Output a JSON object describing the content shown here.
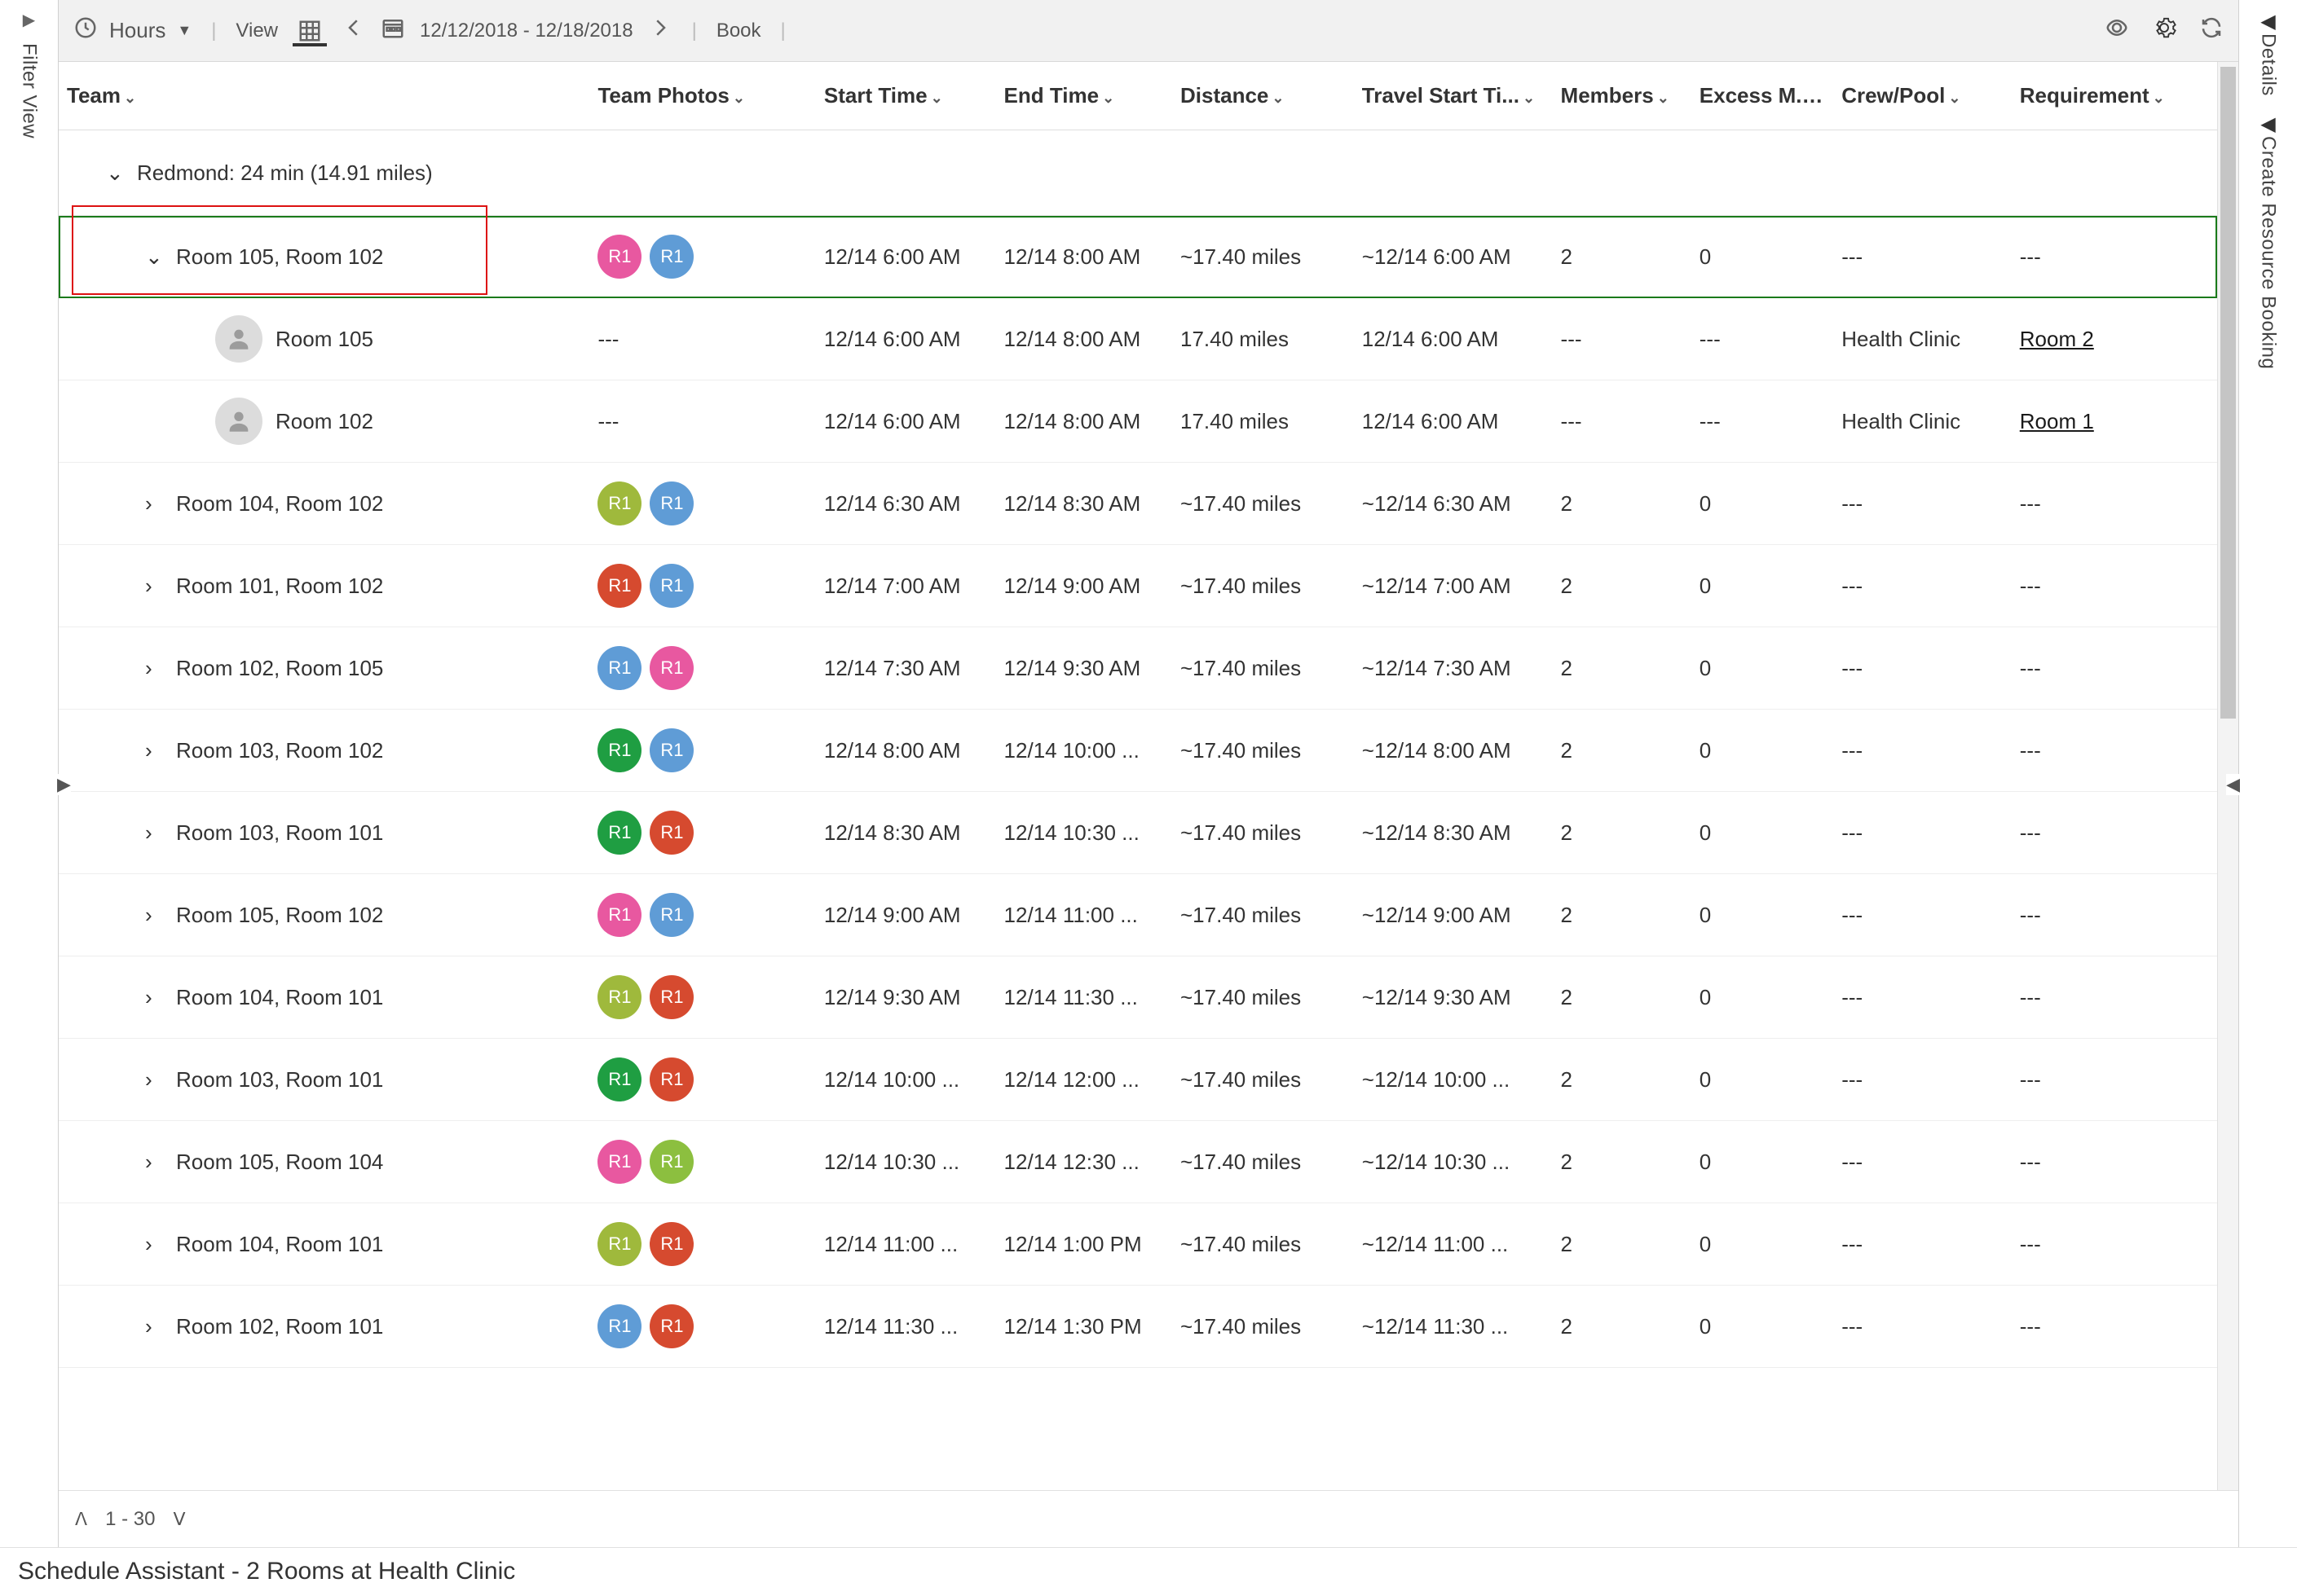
{
  "toolbar": {
    "hours_label": "Hours",
    "view_label": "View",
    "date_range": "12/12/2018 - 12/18/2018",
    "book_label": "Book"
  },
  "left_rail": {
    "label": "Filter View"
  },
  "right_rail_1": {
    "label": "Details"
  },
  "right_rail_2": {
    "label": "Create Resource Booking"
  },
  "columns": {
    "team": "Team",
    "photos": "Team Photos",
    "start": "Start Time",
    "end": "End Time",
    "distance": "Distance",
    "travel_start": "Travel Start Ti...",
    "members": "Members",
    "excess": "Excess M...",
    "crew": "Crew/Pool",
    "req": "Requirement"
  },
  "group": {
    "label": "Redmond: 24 min (14.91 miles)"
  },
  "avatar_text": "R1",
  "rows": [
    {
      "id": 0,
      "expanded": true,
      "pad": 2,
      "team": "Room 105, Room 102",
      "av1": "pink",
      "av2": "blue",
      "start": "12/14 6:00 AM",
      "end": "12/14 8:00 AM",
      "dist": "~17.40 miles",
      "trs": "~12/14 6:00 AM",
      "members": "2",
      "excess": "0",
      "crew": "---",
      "req": "---",
      "selected": true
    },
    {
      "id": 1,
      "leaf": true,
      "pad": 3,
      "team": "Room 105",
      "photos": "---",
      "start": "12/14 6:00 AM",
      "end": "12/14 8:00 AM",
      "dist": "17.40 miles",
      "trs": "12/14 6:00 AM",
      "members": "---",
      "excess": "---",
      "crew": "Health Clinic",
      "req": "Room 2",
      "req_link": true
    },
    {
      "id": 2,
      "leaf": true,
      "pad": 3,
      "team": "Room 102",
      "photos": "---",
      "start": "12/14 6:00 AM",
      "end": "12/14 8:00 AM",
      "dist": "17.40 miles",
      "trs": "12/14 6:00 AM",
      "members": "---",
      "excess": "---",
      "crew": "Health Clinic",
      "req": "Room 1",
      "req_link": true
    },
    {
      "id": 3,
      "pad": 2,
      "team": "Room 104, Room 102",
      "av1": "olive",
      "av2": "blue",
      "start": "12/14 6:30 AM",
      "end": "12/14 8:30 AM",
      "dist": "~17.40 miles",
      "trs": "~12/14 6:30 AM",
      "members": "2",
      "excess": "0",
      "crew": "---",
      "req": "---"
    },
    {
      "id": 4,
      "pad": 2,
      "team": "Room 101, Room 102",
      "av1": "red",
      "av2": "blue",
      "start": "12/14 7:00 AM",
      "end": "12/14 9:00 AM",
      "dist": "~17.40 miles",
      "trs": "~12/14 7:00 AM",
      "members": "2",
      "excess": "0",
      "crew": "---",
      "req": "---"
    },
    {
      "id": 5,
      "pad": 2,
      "team": "Room 102, Room 105",
      "av1": "blue",
      "av2": "pink",
      "start": "12/14 7:30 AM",
      "end": "12/14 9:30 AM",
      "dist": "~17.40 miles",
      "trs": "~12/14 7:30 AM",
      "members": "2",
      "excess": "0",
      "crew": "---",
      "req": "---"
    },
    {
      "id": 6,
      "pad": 2,
      "team": "Room 103, Room 102",
      "av1": "green",
      "av2": "blue",
      "start": "12/14 8:00 AM",
      "end": "12/14 10:00 ...",
      "dist": "~17.40 miles",
      "trs": "~12/14 8:00 AM",
      "members": "2",
      "excess": "0",
      "crew": "---",
      "req": "---"
    },
    {
      "id": 7,
      "pad": 2,
      "team": "Room 103, Room 101",
      "av1": "green",
      "av2": "red",
      "start": "12/14 8:30 AM",
      "end": "12/14 10:30 ...",
      "dist": "~17.40 miles",
      "trs": "~12/14 8:30 AM",
      "members": "2",
      "excess": "0",
      "crew": "---",
      "req": "---"
    },
    {
      "id": 8,
      "pad": 2,
      "team": "Room 105, Room 102",
      "av1": "pink",
      "av2": "blue",
      "start": "12/14 9:00 AM",
      "end": "12/14 11:00 ...",
      "dist": "~17.40 miles",
      "trs": "~12/14 9:00 AM",
      "members": "2",
      "excess": "0",
      "crew": "---",
      "req": "---"
    },
    {
      "id": 9,
      "pad": 2,
      "team": "Room 104, Room 101",
      "av1": "olive",
      "av2": "red",
      "start": "12/14 9:30 AM",
      "end": "12/14 11:30 ...",
      "dist": "~17.40 miles",
      "trs": "~12/14 9:30 AM",
      "members": "2",
      "excess": "0",
      "crew": "---",
      "req": "---"
    },
    {
      "id": 10,
      "pad": 2,
      "team": "Room 103, Room 101",
      "av1": "green",
      "av2": "red",
      "start": "12/14 10:00 ...",
      "end": "12/14 12:00 ...",
      "dist": "~17.40 miles",
      "trs": "~12/14 10:00 ...",
      "members": "2",
      "excess": "0",
      "crew": "---",
      "req": "---"
    },
    {
      "id": 11,
      "pad": 2,
      "team": "Room 105, Room 104",
      "av1": "pink",
      "av2": "lime",
      "start": "12/14 10:30 ...",
      "end": "12/14 12:30 ...",
      "dist": "~17.40 miles",
      "trs": "~12/14 10:30 ...",
      "members": "2",
      "excess": "0",
      "crew": "---",
      "req": "---"
    },
    {
      "id": 12,
      "pad": 2,
      "team": "Room 104, Room 101",
      "av1": "olive",
      "av2": "red",
      "start": "12/14 11:00 ...",
      "end": "12/14 1:00 PM",
      "dist": "~17.40 miles",
      "trs": "~12/14 11:00 ...",
      "members": "2",
      "excess": "0",
      "crew": "---",
      "req": "---"
    },
    {
      "id": 13,
      "pad": 2,
      "team": "Room 102, Room 101",
      "av1": "blue",
      "av2": "red",
      "start": "12/14 11:30 ...",
      "end": "12/14 1:30 PM",
      "dist": "~17.40 miles",
      "trs": "~12/14 11:30 ...",
      "members": "2",
      "excess": "0",
      "crew": "---",
      "req": "---"
    }
  ],
  "pager": {
    "range": "1 - 30"
  },
  "footer": {
    "title": "Schedule Assistant - 2 Rooms at Health Clinic"
  }
}
